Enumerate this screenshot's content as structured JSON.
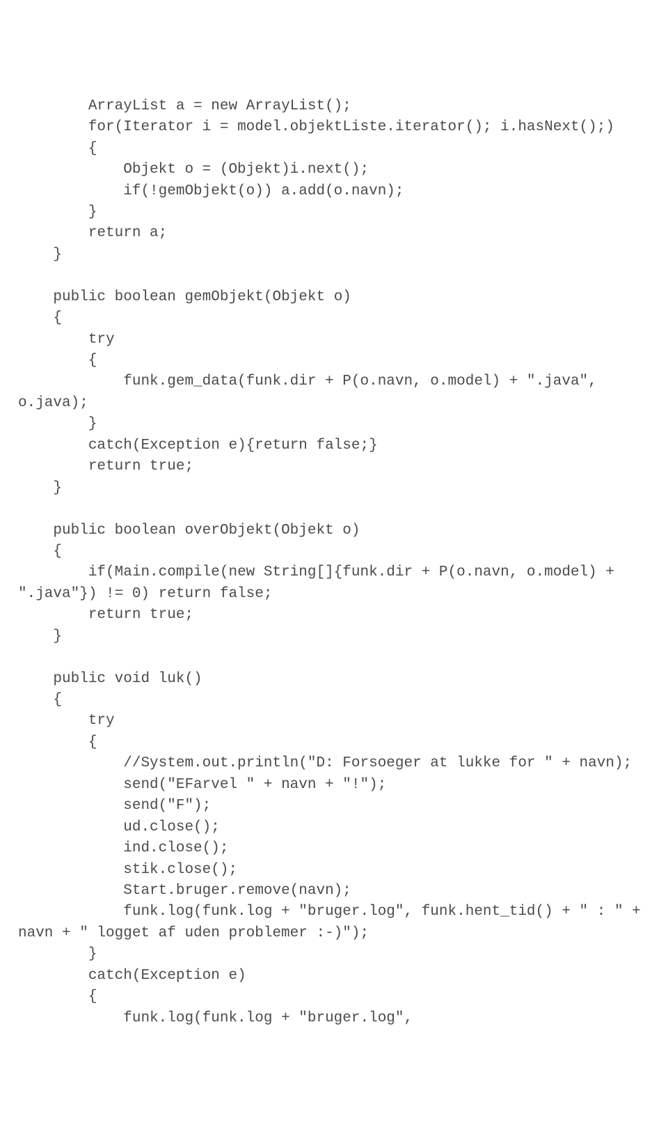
{
  "code": "        ArrayList a = new ArrayList();\n        for(Iterator i = model.objektListe.iterator(); i.hasNext();)\n        {\n            Objekt o = (Objekt)i.next();\n            if(!gemObjekt(o)) a.add(o.navn);\n        }\n        return a;\n    }\n\n    public boolean gemObjekt(Objekt o)\n    {\n        try\n        {\n            funk.gem_data(funk.dir + P(o.navn, o.model) + \".java\", o.java);\n        }\n        catch(Exception e){return false;}\n        return true;\n    }\n\n    public boolean overObjekt(Objekt o)\n    {\n        if(Main.compile(new String[]{funk.dir + P(o.navn, o.model) + \".java\"}) != 0) return false;\n        return true;\n    }\n\n    public void luk()\n    {\n        try\n        {\n            //System.out.println(\"D: Forsoeger at lukke for \" + navn);\n            send(\"EFarvel \" + navn + \"!\");\n            send(\"F\");\n            ud.close();\n            ind.close();\n            stik.close();\n            Start.bruger.remove(navn);\n            funk.log(funk.log + \"bruger.log\", funk.hent_tid() + \" : \" + navn + \" logget af uden problemer :-)\");\n        }\n        catch(Exception e)\n        {\n            funk.log(funk.log + \"bruger.log\","
}
